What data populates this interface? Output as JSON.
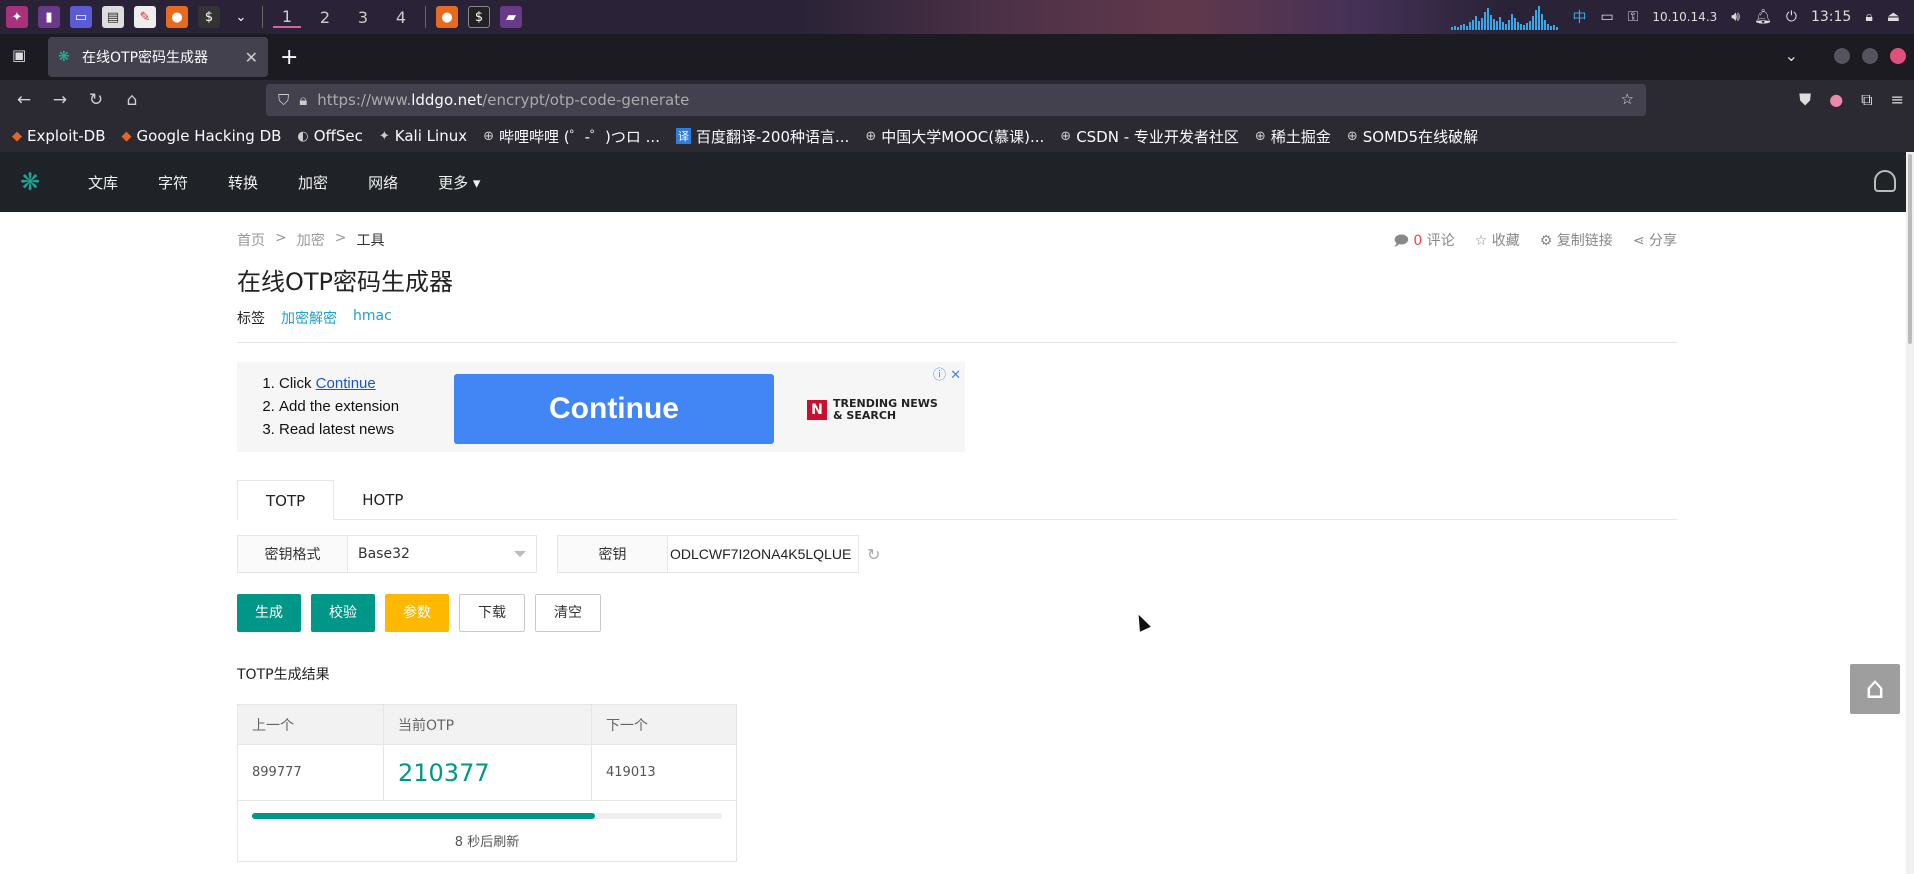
{
  "taskbar": {
    "workspaces": [
      "1",
      "2",
      "3",
      "4"
    ],
    "ip": "10.10.14.3",
    "ime": "中",
    "time": "13:15"
  },
  "browser": {
    "tab_title": "在线OTP密码生成器",
    "url_prefix": "https://www.",
    "url_host": "lddgo.net",
    "url_path": "/encrypt/otp-code-generate"
  },
  "bookmarks": [
    {
      "label": "Exploit-DB",
      "icon": "exploit-db-icon"
    },
    {
      "label": "Google Hacking DB",
      "icon": "ghdb-icon"
    },
    {
      "label": "OffSec",
      "icon": "offsec-icon"
    },
    {
      "label": "Kali Linux",
      "icon": "kali-icon"
    },
    {
      "label": "哔哩哔哩 (゜-゜)つロ ...",
      "icon": "globe-icon"
    },
    {
      "label": "百度翻译-200种语言...",
      "icon": "baidu-translate-icon"
    },
    {
      "label": "中国大学MOOC(慕课)...",
      "icon": "globe-icon"
    },
    {
      "label": "CSDN - 专业开发者社区",
      "icon": "globe-icon"
    },
    {
      "label": "稀土掘金",
      "icon": "globe-icon"
    },
    {
      "label": "SOMD5在线破解",
      "icon": "globe-icon"
    }
  ],
  "site": {
    "menu": [
      "文库",
      "字符",
      "转换",
      "加密",
      "网络",
      "更多"
    ]
  },
  "page": {
    "breadcrumb": [
      "首页",
      ">",
      "加密",
      ">",
      "工具"
    ],
    "actions": {
      "comment_count": "0",
      "comment": "评论",
      "favorite": "收藏",
      "copy_link": "复制链接",
      "share": "分享"
    },
    "title": "在线OTP密码生成器",
    "tags_label": "标签",
    "tags": [
      "加密解密",
      "hmac"
    ]
  },
  "ad": {
    "step1_prefix": "Click ",
    "step1_link": "Continue",
    "step2": "Add the extension",
    "step3": "Read latest news",
    "cta": "Continue",
    "brand_line1": "TRENDING NEWS",
    "brand_line2": "& SEARCH"
  },
  "tabs": [
    "TOTP",
    "HOTP"
  ],
  "form": {
    "key_format_label": "密钥格式",
    "key_format_value": "Base32",
    "key_label": "密钥",
    "key_value": "ODLCWF7I2ONA4K5LQLUE"
  },
  "buttons": {
    "generate": "生成",
    "verify": "校验",
    "params": "参数",
    "download": "下载",
    "clear": "清空"
  },
  "result": {
    "title": "TOTP生成结果",
    "headers": [
      "上一个",
      "当前OTP",
      "下一个"
    ],
    "previous": "899777",
    "current": "210377",
    "next": "419013",
    "progress_fraction": 0.73,
    "refresh_text": "8 秒后刷新"
  },
  "colors": {
    "accent": "#009688",
    "warning": "#ffb800",
    "link": "#22a0c8"
  }
}
